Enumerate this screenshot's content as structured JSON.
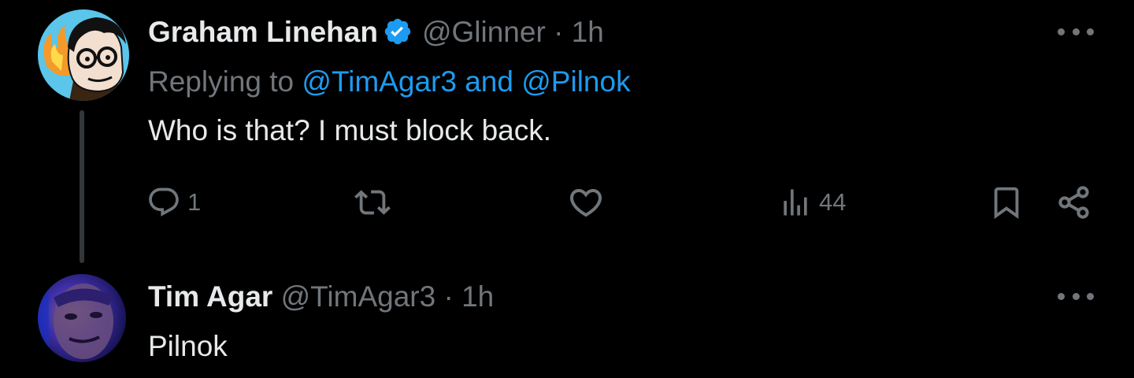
{
  "tweet1": {
    "display_name": "Graham Linehan",
    "verified": true,
    "handle": "@Glinner",
    "separator": "·",
    "time": "1h",
    "replying_prefix": "Replying to",
    "mention1": "@TimAgar3",
    "conjunction": "and",
    "mention2": "@Pilnok",
    "text": "Who is that? I must block back.",
    "reply_count": "1",
    "views_count": "44",
    "icons": [
      "more-icon",
      "reply-icon",
      "retweet-icon",
      "like-icon",
      "views-icon",
      "bookmark-icon",
      "share-icon",
      "verified-badge-icon"
    ]
  },
  "tweet2": {
    "display_name": "Tim Agar",
    "handle": "@TimAgar3",
    "separator": "·",
    "time": "1h",
    "text": "Pilnok",
    "icons": [
      "more-icon"
    ]
  },
  "colors": {
    "background": "#000000",
    "text": "#e7e9ea",
    "secondary": "#71767b",
    "accent": "#1d9bf0",
    "thread_line": "#333639"
  }
}
